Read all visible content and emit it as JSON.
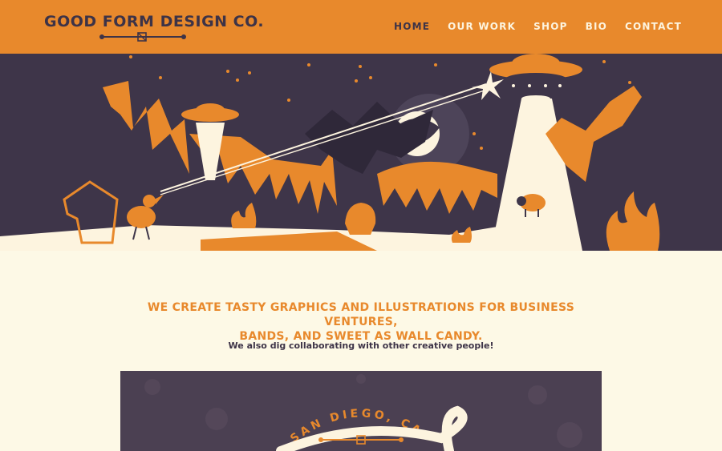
{
  "brand": {
    "name": "GOOD FORM DESIGN CO."
  },
  "nav": {
    "items": [
      {
        "label": "HOME",
        "active": true
      },
      {
        "label": "OUR WORK",
        "active": false
      },
      {
        "label": "SHOP",
        "active": false
      },
      {
        "label": "BIO",
        "active": false
      },
      {
        "label": "CONTACT",
        "active": false
      }
    ]
  },
  "intro": {
    "headline_line1": "WE CREATE TASTY GRAPHICS AND ILLUSTRATIONS FOR BUSINESS VENTURES,",
    "headline_line2": "BANDS, AND SWEET AS WALL CANDY.",
    "subline": "We also dig collaborating with other creative people!"
  },
  "badge": {
    "arc_text": "SAN DIEGO, CA"
  },
  "colors": {
    "orange": "#e8892c",
    "plum": "#3d3347",
    "cream": "#fdf9e6"
  }
}
